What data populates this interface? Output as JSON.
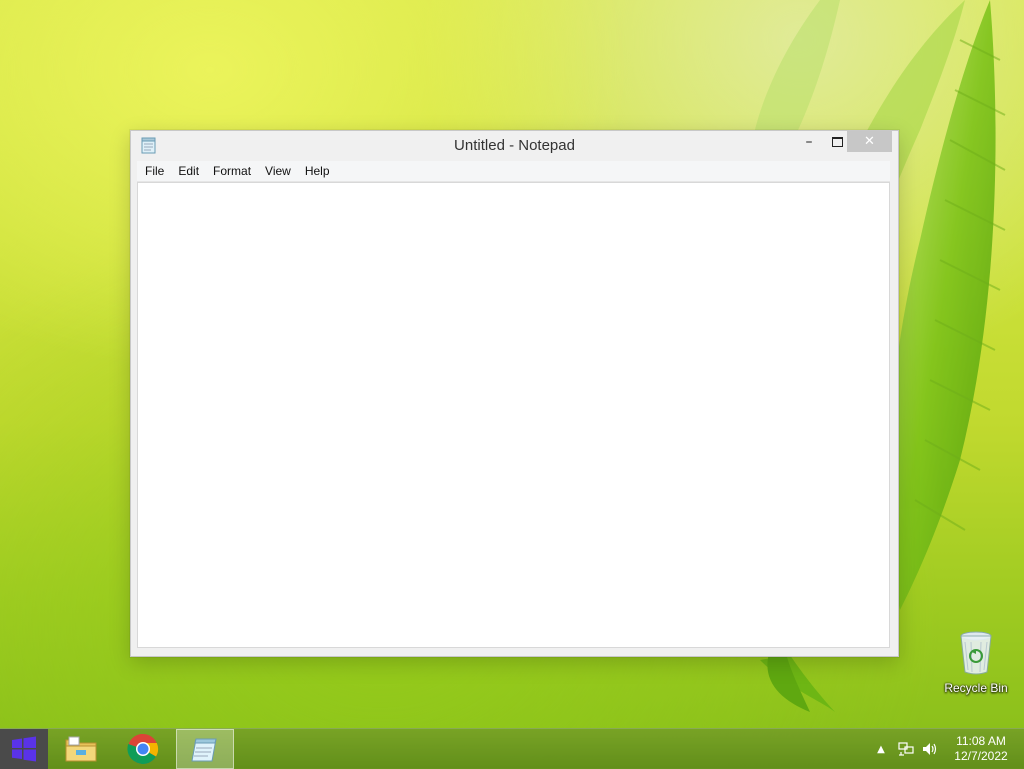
{
  "window": {
    "title": "Untitled - Notepad",
    "controls": {
      "minimize": "–",
      "maximize_icon": "maximize-icon",
      "close": "✕"
    }
  },
  "menu": [
    {
      "label": "File"
    },
    {
      "label": "Edit"
    },
    {
      "label": "Format"
    },
    {
      "label": "View"
    },
    {
      "label": "Help"
    }
  ],
  "editor": {
    "content": ""
  },
  "desktop": {
    "icons": [
      {
        "label": "Recycle Bin",
        "icon": "recycle-bin-icon"
      }
    ]
  },
  "taskbar": {
    "start_icon": "windows-logo-icon",
    "apps": [
      {
        "name": "File Explorer",
        "icon": "folder-icon",
        "active": false
      },
      {
        "name": "Google Chrome",
        "icon": "chrome-icon",
        "active": false
      },
      {
        "name": "Notepad",
        "icon": "notepad-icon",
        "active": true
      }
    ],
    "tray": {
      "chevron": "▲",
      "icons": [
        "network-icon",
        "volume-icon"
      ],
      "time": "11:08 AM",
      "date": "12/7/2022"
    }
  },
  "colors": {
    "start_accent": "#4b2bd8",
    "window_bg": "#f0f0f0",
    "close_button": "#c7c7c7",
    "desktop_green": "#9fcb21"
  }
}
